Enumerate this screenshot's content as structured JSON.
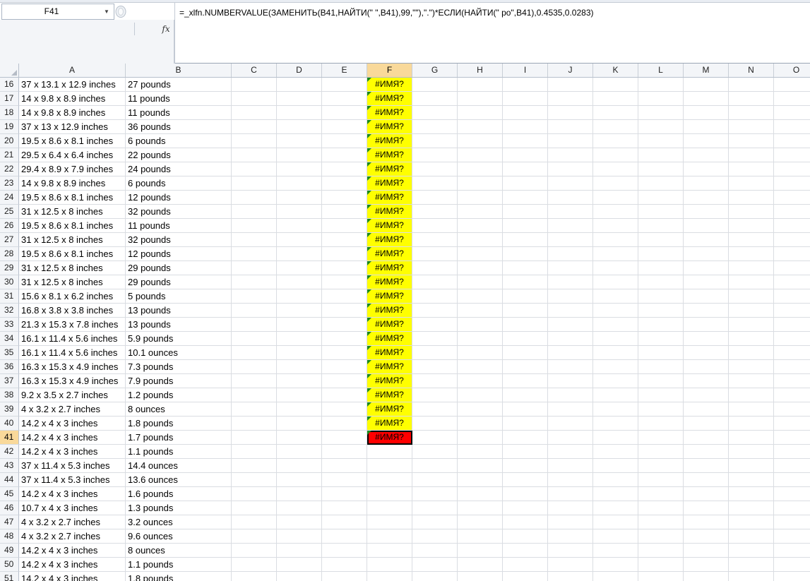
{
  "name_box": {
    "value": "F41"
  },
  "formula_bar": {
    "fx_label": "fx",
    "formula": "=_xlfn.NUMBERVALUE(ЗАМЕНИТЬ(B41,НАЙТИ(\" \",B41),99,\"\"),\".\")*ЕСЛИ(НАЙТИ(\" po\",B41),0.4535,0.0283)"
  },
  "columns": [
    "A",
    "B",
    "C",
    "D",
    "E",
    "F",
    "G",
    "H",
    "I",
    "J",
    "K",
    "L",
    "M",
    "N",
    "O"
  ],
  "active_column": "F",
  "active_row": 41,
  "rows": [
    {
      "n": "16",
      "a": "37 x 13.1 x 12.9 inches",
      "b": "27 pounds",
      "f": "#ИМЯ?"
    },
    {
      "n": "17",
      "a": "14 x 9.8 x 8.9 inches",
      "b": "11 pounds",
      "f": "#ИМЯ?"
    },
    {
      "n": "18",
      "a": "14 x 9.8 x 8.9 inches",
      "b": "11 pounds",
      "f": "#ИМЯ?"
    },
    {
      "n": "19",
      "a": "37 x 13 x 12.9 inches",
      "b": "36 pounds",
      "f": "#ИМЯ?"
    },
    {
      "n": "20",
      "a": "19.5 x 8.6 x 8.1 inches",
      "b": "6 pounds",
      "f": "#ИМЯ?"
    },
    {
      "n": "21",
      "a": "29.5 x 6.4 x 6.4 inches",
      "b": "22 pounds",
      "f": "#ИМЯ?"
    },
    {
      "n": "22",
      "a": "29.4 x 8.9 x 7.9 inches",
      "b": "24 pounds",
      "f": "#ИМЯ?"
    },
    {
      "n": "23",
      "a": "14 x 9.8 x 8.9 inches",
      "b": "6 pounds",
      "f": "#ИМЯ?"
    },
    {
      "n": "24",
      "a": "19.5 x 8.6 x 8.1 inches",
      "b": "12 pounds",
      "f": "#ИМЯ?"
    },
    {
      "n": "25",
      "a": "31 x 12.5 x 8 inches",
      "b": "32 pounds",
      "f": "#ИМЯ?"
    },
    {
      "n": "26",
      "a": "19.5 x 8.6 x 8.1 inches",
      "b": "11 pounds",
      "f": "#ИМЯ?"
    },
    {
      "n": "27",
      "a": "31 x 12.5 x 8 inches",
      "b": "32 pounds",
      "f": "#ИМЯ?"
    },
    {
      "n": "28",
      "a": "19.5 x 8.6 x 8.1 inches",
      "b": "12 pounds",
      "f": "#ИМЯ?"
    },
    {
      "n": "29",
      "a": "31 x 12.5 x 8 inches",
      "b": "29 pounds",
      "f": "#ИМЯ?"
    },
    {
      "n": "30",
      "a": "31 x 12.5 x 8 inches",
      "b": "29 pounds",
      "f": "#ИМЯ?"
    },
    {
      "n": "31",
      "a": "15.6 x 8.1 x 6.2 inches",
      "b": "5 pounds",
      "f": "#ИМЯ?"
    },
    {
      "n": "32",
      "a": "16.8 x 3.8 x 3.8 inches",
      "b": "13 pounds",
      "f": "#ИМЯ?"
    },
    {
      "n": "33",
      "a": "21.3 x 15.3 x 7.8 inches",
      "b": "13 pounds",
      "f": "#ИМЯ?"
    },
    {
      "n": "34",
      "a": "16.1 x 11.4 x 5.6 inches",
      "b": "5.9 pounds",
      "f": "#ИМЯ?"
    },
    {
      "n": "35",
      "a": "16.1 x 11.4 x 5.6 inches",
      "b": "10.1 ounces",
      "f": "#ИМЯ?"
    },
    {
      "n": "36",
      "a": "16.3 x 15.3 x 4.9 inches",
      "b": "7.3 pounds",
      "f": "#ИМЯ?"
    },
    {
      "n": "37",
      "a": "16.3 x 15.3 x 4.9 inches",
      "b": "7.9 pounds",
      "f": "#ИМЯ?"
    },
    {
      "n": "38",
      "a": "9.2 x 3.5 x 2.7 inches",
      "b": "1.2 pounds",
      "f": "#ИМЯ?"
    },
    {
      "n": "39",
      "a": "4 x 3.2 x 2.7 inches",
      "b": "8 ounces",
      "f": "#ИМЯ?"
    },
    {
      "n": "40",
      "a": "14.2 x 4 x 3 inches",
      "b": "1.8 pounds",
      "f": "#ИМЯ?"
    },
    {
      "n": "41",
      "a": "14.2 x 4 x 3 inches",
      "b": "1.7 pounds",
      "f": "#ИМЯ?"
    },
    {
      "n": "42",
      "a": "14.2 x 4 x 3 inches",
      "b": "1.1 pounds",
      "f": ""
    },
    {
      "n": "43",
      "a": "37 x 11.4 x 5.3 inches",
      "b": "14.4 ounces",
      "f": ""
    },
    {
      "n": "44",
      "a": "37 x 11.4 x 5.3 inches",
      "b": "13.6 ounces",
      "f": ""
    },
    {
      "n": "45",
      "a": "14.2 x 4 x 3 inches",
      "b": "1.6 pounds",
      "f": ""
    },
    {
      "n": "46",
      "a": "10.7 x 4 x 3 inches",
      "b": "1.3 pounds",
      "f": ""
    },
    {
      "n": "47",
      "a": "4 x 3.2 x 2.7 inches",
      "b": "3.2 ounces",
      "f": ""
    },
    {
      "n": "48",
      "a": "4 x 3.2 x 2.7 inches",
      "b": "9.6 ounces",
      "f": ""
    },
    {
      "n": "49",
      "a": "14.2 x 4 x 3 inches",
      "b": "8 ounces",
      "f": ""
    },
    {
      "n": "50",
      "a": "14.2 x 4 x 3 inches",
      "b": "1.1 pounds",
      "f": ""
    },
    {
      "n": "51",
      "a": "14.2 x 4 x 3 inches",
      "b": "1.8 pounds",
      "f": ""
    }
  ],
  "colors": {
    "error_fill": "#ffff00",
    "selected_error_fill": "#ff0000",
    "header_active": "#f9d99a",
    "error_indicator": "#1a8a1a"
  },
  "icons": {
    "namebox_dropdown": "chevron-down-icon",
    "formula_fx": "fx-icon",
    "error_indicator": "error-triangle-icon"
  }
}
